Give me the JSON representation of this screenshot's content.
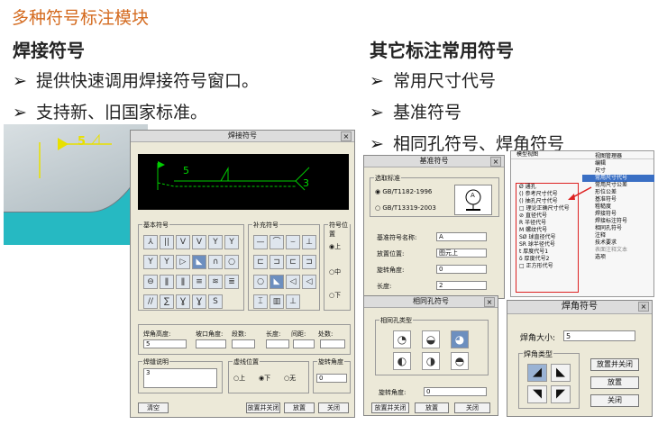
{
  "slide": {
    "title": "多种符号标注模块",
    "left_heading": "焊接符号",
    "left_bullets": [
      "提供快速调用焊接符号窗口。",
      "支持新、旧国家标准。"
    ],
    "right_heading": "其它标注常用符号",
    "right_bullets": [
      "常用尺寸代号",
      "基准符号",
      "相同孔符号、焊角符号"
    ],
    "bullet_glyph": "➢"
  },
  "model_view": {
    "label": "5"
  },
  "weld_dialog": {
    "title": "焊接符号",
    "preview_number_left": "5",
    "preview_number_right": "3",
    "groups": {
      "basic": "基本符号",
      "supplement": "补充符号",
      "position": "符号位置",
      "weld_desc": "焊缝说明",
      "dim_line": "虚线位置",
      "angle": "旋转角度"
    },
    "position_options": [
      "上",
      "中",
      "下"
    ],
    "fields": {
      "fillet_height_label": "焊角高度:",
      "fillet_height_value": "5",
      "groove_angle_label": "坡口角度:",
      "segments_label": "段数:",
      "length_label": "长度:",
      "gap_label": "间距:",
      "count_label": "处数:",
      "weld_desc_value": "3",
      "angle_value": "0"
    },
    "dash_options": [
      "上",
      "下",
      "无"
    ],
    "buttons": {
      "clear": "清空",
      "place_close": "放置并关闭",
      "place": "放置",
      "close": "关闭"
    }
  },
  "datum_dialog": {
    "title": "基准符号",
    "std_group": "选取标准",
    "std_options": [
      "GB/T1182-1996",
      "GB/T13319-2003"
    ],
    "symbol_letter": "A",
    "name_label": "基准符号名称:",
    "name_value": "A",
    "place_label": "放置位置:",
    "place_value": "图元上",
    "angle_label": "旋转角度:",
    "angle_value": "0",
    "length_label": "长度:",
    "length_value": "2"
  },
  "menu": {
    "header": "模型视图",
    "items": [
      "视图管理器",
      "编辑",
      "尺寸",
      "常用尺寸代号",
      "常用尺寸公差",
      "形位公差",
      "基准符号",
      "粗糙度",
      "焊接符号",
      "焊接标注符号",
      "相同孔符号",
      "注释",
      "技术要求",
      "表面注释文本",
      "选项"
    ],
    "sub_items": [
      "通孔",
      "参考尺寸代号",
      "抽孔尺寸代号",
      "理论正确尺寸代号",
      "直径代号",
      "半径代号",
      "螺纹代号",
      "球直径代号",
      "球半径代号",
      "厚度代号1",
      "厚度代号2",
      "正方形代号"
    ],
    "sub_icons": [
      "Ø",
      "()",
      "()",
      "□",
      "⊘",
      "R",
      "M",
      "SØ",
      "SR",
      "t",
      "δ",
      "□"
    ]
  },
  "hole_dialog": {
    "title": "相同孔符号",
    "group": "相同孔类型",
    "angle_label": "旋转角度:",
    "angle_value": "0",
    "buttons": {
      "place_close": "放置并关闭",
      "place": "放置",
      "close": "关闭"
    }
  },
  "fillet_dialog": {
    "title": "焊角符号",
    "size_label": "焊角大小:",
    "size_value": "5",
    "group": "焊角类型",
    "buttons": {
      "place_close": "放置并关闭",
      "place": "放置",
      "close": "关闭"
    }
  }
}
